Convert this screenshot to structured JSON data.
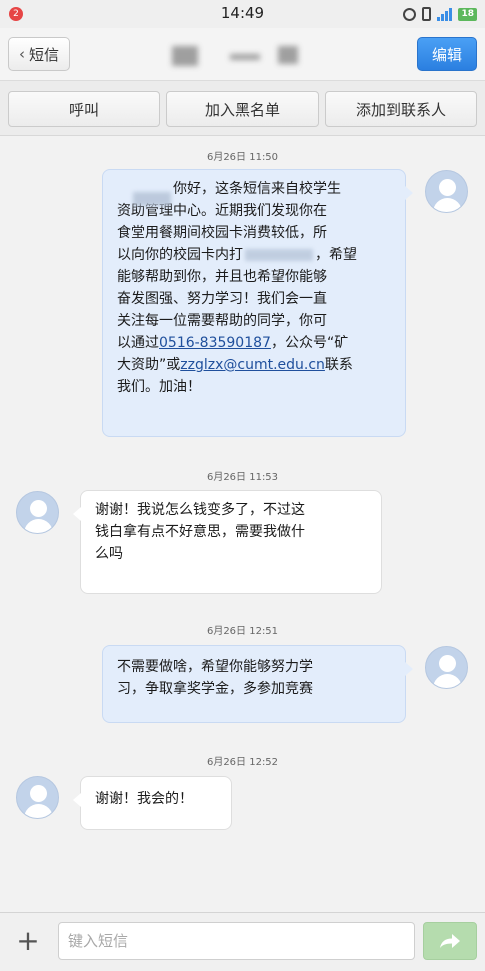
{
  "status_bar": {
    "notification_count": "2",
    "time": "14:49",
    "battery": "18",
    "icons": [
      "alarm-icon",
      "vibrate-icon",
      "signal-icon",
      "battery-icon"
    ]
  },
  "header": {
    "back_label": "短信",
    "edit_label": "编辑"
  },
  "actions": {
    "call": "呼叫",
    "blacklist": "加入黑名单",
    "add_contact": "添加到联系人"
  },
  "messages": [
    {
      "timestamp": "6月26日 11:50",
      "direction": "out",
      "lines": [
        "你好，这条短信来自校学生",
        "资助管理中心。近期我们发现你在",
        "食堂用餐期间校园卡消费较低，所",
        "以向你的校园卡内打",
        "，希望",
        "能够帮助到你，并且也希望你能够",
        "奋发图强、努力学习！我们会一直",
        "关注每一位需要帮助的同学，你可",
        "以通过",
        "0516-83590187",
        "，公众号“矿",
        "大资助”或",
        "zzglzx@cumt.edu.cn",
        "联系",
        "我们。加油！"
      ]
    },
    {
      "timestamp": "6月26日 11:53",
      "direction": "in",
      "lines": [
        "谢谢！我说怎么钱变多了，不过这",
        "钱白拿有点不好意思，需要我做什",
        "么吗"
      ]
    },
    {
      "timestamp": "6月26日 12:51",
      "direction": "out",
      "lines": [
        "不需要做啥，希望你能够努力学",
        "习，争取拿奖学金，多参加竞赛"
      ]
    },
    {
      "timestamp": "6月26日 12:52",
      "direction": "in",
      "lines": [
        "谢谢！我会的！"
      ]
    }
  ],
  "composer": {
    "placeholder": "键入短信"
  },
  "colors": {
    "accent": "#2b7fe0",
    "outgoing_bubble": "#e3edfb",
    "incoming_bubble": "#ffffff",
    "send_button": "#b5dcae",
    "badge": "#e64545"
  }
}
